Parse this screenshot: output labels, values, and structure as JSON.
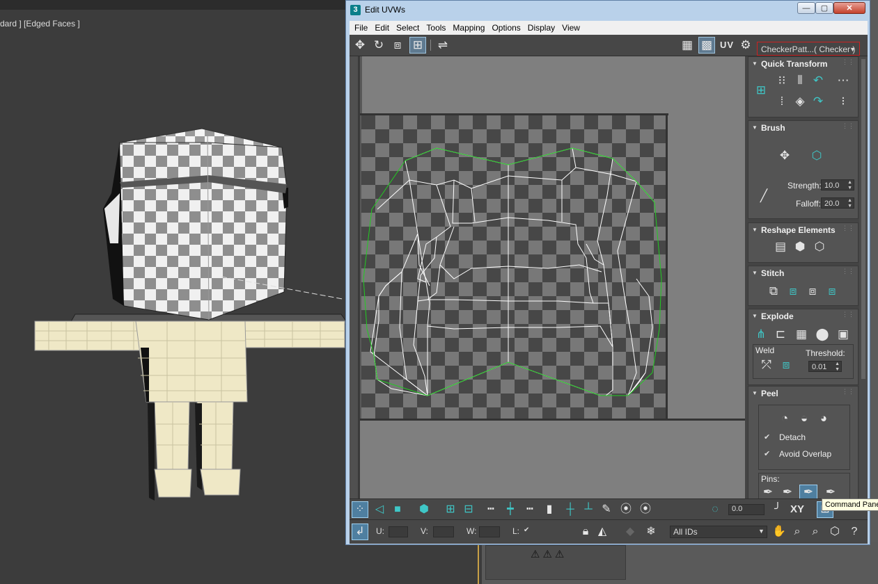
{
  "viewport": {
    "label": "dard ] [Edged Faces ]"
  },
  "window": {
    "title": "Edit UVWs",
    "app_icon_text": "3",
    "min_glyph": "—",
    "max_glyph": "▢",
    "close_glyph": "✕"
  },
  "menu": [
    "File",
    "Edit",
    "Select",
    "Tools",
    "Mapping",
    "Options",
    "Display",
    "View"
  ],
  "toolbar": {
    "uv_label": "UV",
    "checker_value": "CheckerPatt...( Checker )",
    "checker_arrow": "▼",
    "icons": {
      "move": "✥",
      "rotate": "↻",
      "scale": "⧈",
      "freeform": "⊞",
      "mirror": "⇌",
      "checker_toggle": "▦",
      "checker_show": "▩",
      "checker_settings": "⚙"
    }
  },
  "panel": {
    "quick_transform": {
      "title": "Quick Transform"
    },
    "brush": {
      "title": "Brush",
      "strength_label": "Strength:",
      "strength_value": "10.0",
      "falloff_label": "Falloff:",
      "falloff_value": "20.0"
    },
    "reshape": {
      "title": "Reshape Elements"
    },
    "stitch": {
      "title": "Stitch"
    },
    "explode": {
      "title": "Explode",
      "weld_label": "Weld",
      "threshold_label": "Threshold:",
      "threshold_value": "0.01"
    },
    "peel": {
      "title": "Peel",
      "detach_label": "Detach",
      "avoid_overlap_label": "Avoid Overlap",
      "pins_label": "Pins:",
      "check_glyph": "✔"
    }
  },
  "bottom": {
    "angle_value": "0.0",
    "xy_label": "XY",
    "u_label": "U:",
    "v_label": "V:",
    "w_label": "W:",
    "l_label": "L:",
    "l_check": "✔",
    "ids_value": "All IDs",
    "ids_arrow": "▼"
  },
  "tooltip": {
    "text": "Command Panel"
  },
  "colors": {
    "seam": "#22cc22",
    "edge": "#ffffff",
    "accent": "#3fc7c7",
    "checker_dark": "#474747",
    "checker_light": "#787878",
    "body_fill": "#efe8c6",
    "head_light": "#f0f0f0",
    "head_dark": "#8e8e8e"
  }
}
